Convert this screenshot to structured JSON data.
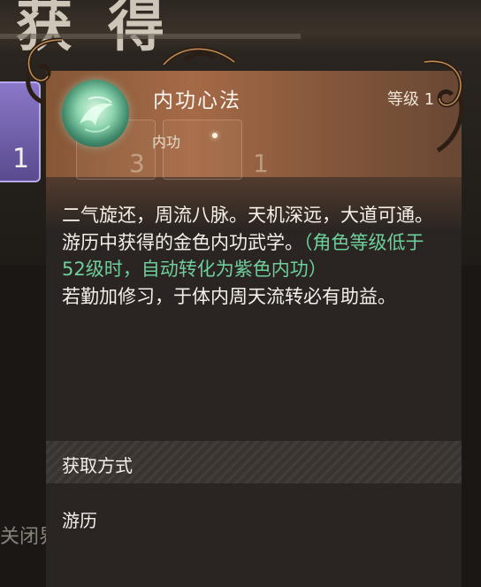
{
  "background": {
    "banner_text": "获得",
    "close_hint": "点击空白处关闭界面",
    "close_hint_visible": "关闭界面",
    "slot_counts": [
      "1",
      "3",
      "1"
    ]
  },
  "item": {
    "name": "内功心法",
    "level": "等级 1",
    "type": "内功",
    "icon": "jade-swirl-icon"
  },
  "description": {
    "line1": "二气旋还，周流八脉。天机深远，大道可通。",
    "line2_main": "游历中获得的金色内功武学。",
    "line2_hint": "（角色等级低于52级时，自动转化为紫色内功）",
    "line3": "若勤加修习，于体内周天流转必有助益。"
  },
  "acquire": {
    "title": "获取方式",
    "source": "游历"
  },
  "colors": {
    "header_accent": "#b0704a",
    "hint_green": "#6fcf9b",
    "panel_bg": "#2a2522"
  }
}
